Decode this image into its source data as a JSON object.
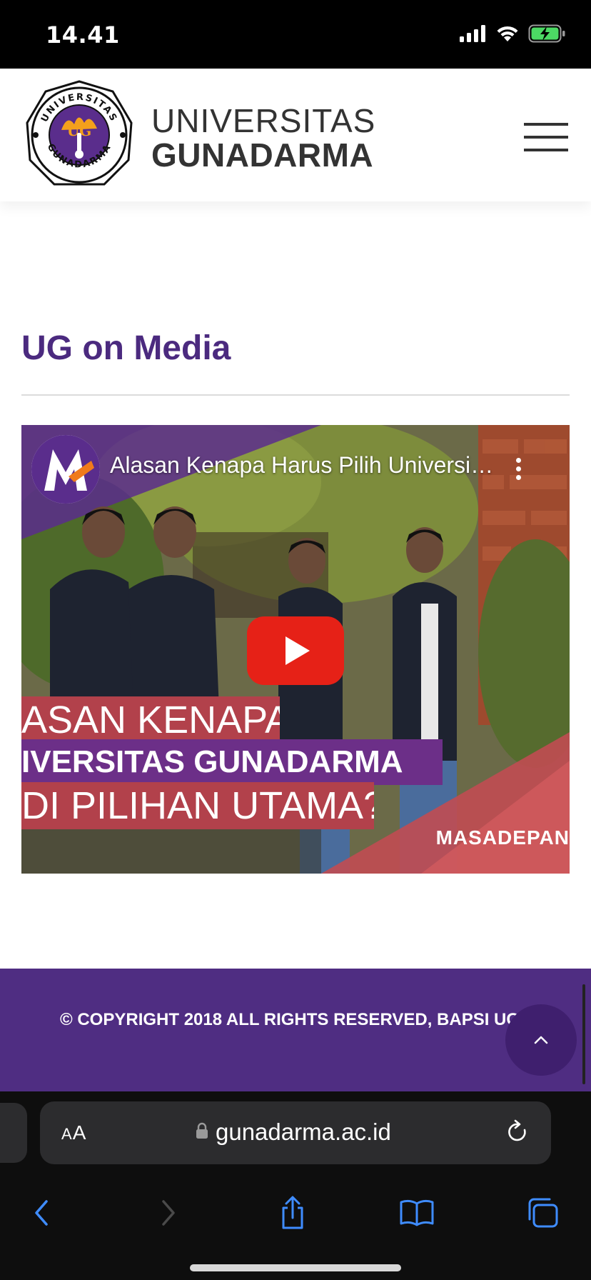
{
  "status_bar": {
    "time": "14.41"
  },
  "header": {
    "brand_line1": "UNIVERSITAS",
    "brand_line2": "GUNADARMA",
    "logo_ring_top": "UNIVERSITAS",
    "logo_ring_bottom": "GUNADARMA",
    "logo_mark": "UG"
  },
  "section": {
    "title": "UG on Media"
  },
  "video": {
    "title": "Alasan Kenapa Harus Pilih Universitas Gunadarma",
    "thumbnail_line1": "ASAN KENAPA",
    "thumbnail_line2": "IVERSITAS GUNADARMA",
    "thumbnail_line3": "DI PILIHAN UTAMA?",
    "thumbnail_brand": "MASADEPAN"
  },
  "footer": {
    "copyright": "© COPYRIGHT 2018 ALL RIGHTS RESERVED, BAPSI UG"
  },
  "browser": {
    "aa_label_small": "A",
    "aa_label_large": "A",
    "url": "gunadarma.ac.id"
  },
  "colors": {
    "brand_purple": "#4b2a7f",
    "footer_purple": "#4f2d82",
    "back_to_top": "#3f1f6e",
    "youtube_red": "#e62117",
    "safari_blue": "#3f8cff",
    "battery_green": "#4cd964"
  },
  "icons": [
    "signal-icon",
    "wifi-icon",
    "battery-charging-icon",
    "hamburger-menu-icon",
    "play-icon",
    "more-vert-icon",
    "chevron-up-icon",
    "lock-icon",
    "reload-icon",
    "back-icon",
    "forward-icon",
    "share-icon",
    "bookmarks-icon",
    "tabs-icon"
  ]
}
